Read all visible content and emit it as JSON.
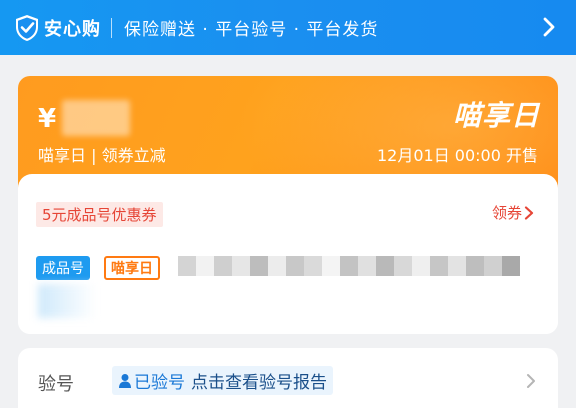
{
  "header": {
    "brand": "安心购",
    "slogan": "保险赠送 · 平台验号 · 平台发货"
  },
  "promo_card": {
    "currency": "¥",
    "event_title": "喵享日",
    "subtitle": "喵享日 | 领券立减",
    "start_time": "12月01日 00:00 开售"
  },
  "coupon": {
    "label": "5元成品号优惠券",
    "claim": "领券"
  },
  "product": {
    "tag_type": "成品号",
    "tag_event": "喵享日"
  },
  "verify_row": {
    "label": "验号",
    "status": "已验号",
    "link": "点击查看验号报告"
  },
  "colors": {
    "brand_blue": "#1a8ff0",
    "promo_orange": "#ff9b1f",
    "coupon_red": "#e64536"
  }
}
